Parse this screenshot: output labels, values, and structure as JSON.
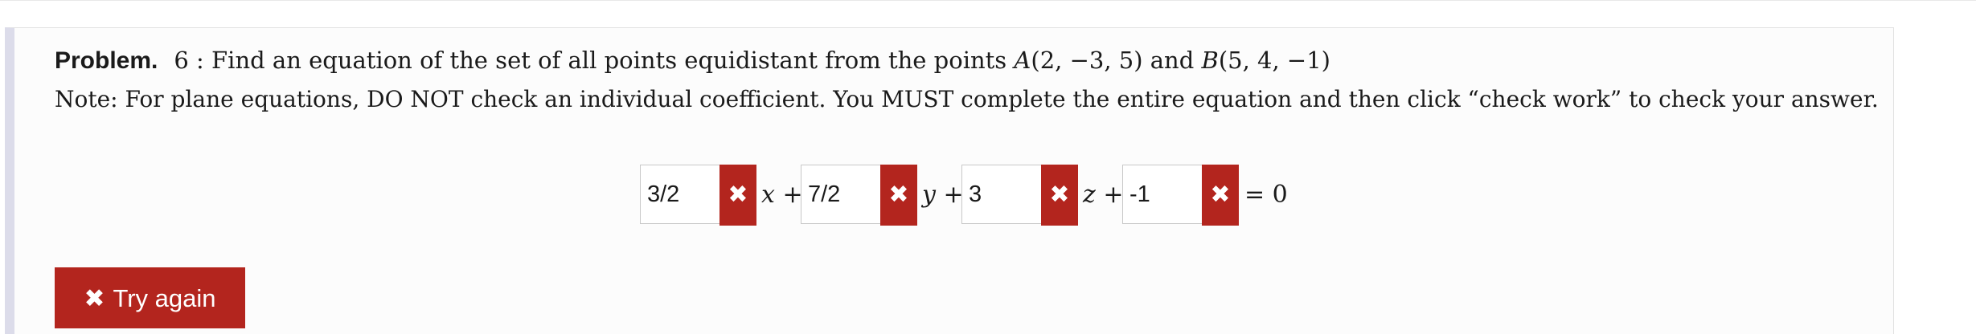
{
  "problem": {
    "label": "Problem.",
    "number": "6 : ",
    "statement_prefix": "Find an equation of the set of all points equidistant from the points ",
    "point_a_name": "A",
    "point_a_coords": "(2, −3, 5)",
    "conjunction": " and ",
    "point_b_name": "B",
    "point_b_coords": "(5, 4, −1)",
    "note": "Note: For plane equations, DO NOT check an individual coefficient. You MUST complete the entire equation and then click “check work” to check your answer."
  },
  "equation": {
    "fields": [
      {
        "value": "3/2",
        "status": "incorrect"
      },
      {
        "value": "7/2",
        "status": "incorrect"
      },
      {
        "value": "3",
        "status": "incorrect"
      },
      {
        "value": "-1",
        "status": "incorrect"
      }
    ],
    "wrong_glyph": "✖",
    "term_x": "x +",
    "term_y": "y +",
    "term_z": "z +",
    "rhs": "= 0"
  },
  "actions": {
    "try_again_glyph": "✖",
    "try_again_label": "Try again"
  },
  "colors": {
    "error_red": "#b3251e",
    "panel_border_accent": "#dcdcea"
  }
}
